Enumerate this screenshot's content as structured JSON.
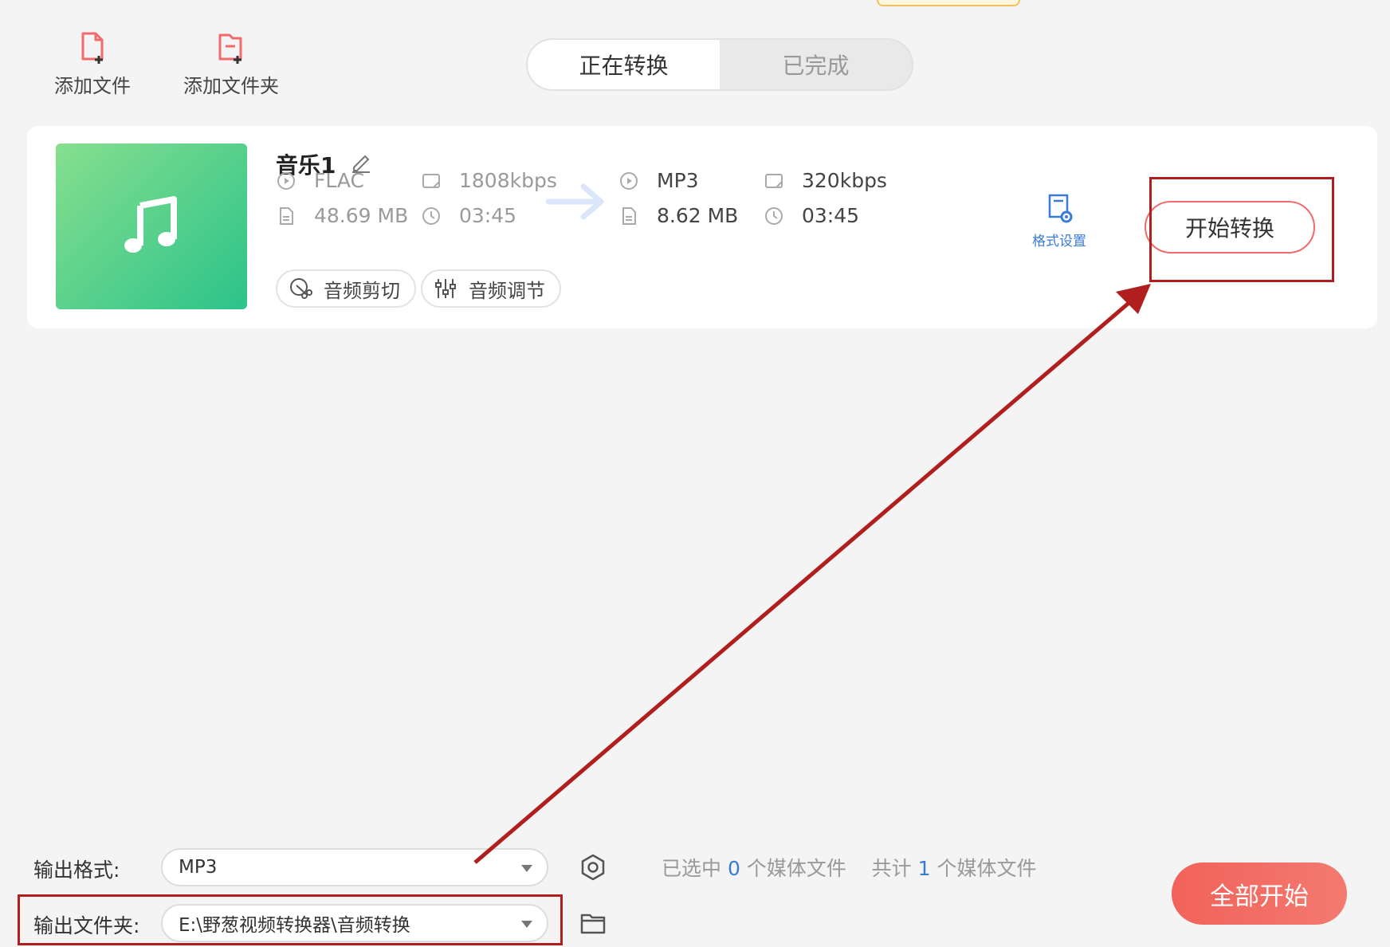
{
  "toolbar": {
    "add_file": "添加文件",
    "add_folder": "添加文件夹"
  },
  "tabs": {
    "converting": "正在转换",
    "completed": "已完成"
  },
  "file": {
    "name": "音乐1",
    "source": {
      "format": "FLAC",
      "bitrate": "1808kbps",
      "size": "48.69 MB",
      "duration": "03:45"
    },
    "target": {
      "format": "MP3",
      "bitrate": "320kbps",
      "size": "8.62 MB",
      "duration": "03:45"
    },
    "audio_cut": "音频剪切",
    "audio_adjust": "音频调节",
    "format_settings": "格式设置",
    "start_convert": "开始转换"
  },
  "bottom": {
    "output_format_label": "输出格式:",
    "output_format_value": "MP3",
    "output_folder_label": "输出文件夹:",
    "output_folder_value": "E:\\野葱视频转换器\\音频转换",
    "selected_prefix": "已选中",
    "selected_count": "0",
    "selected_suffix": "个媒体文件",
    "total_prefix": "共计",
    "total_count": "1",
    "total_suffix": "个媒体文件",
    "start_all": "全部开始"
  },
  "colors": {
    "accent_red": "#f2625a",
    "thumb_green_start": "#86df8e",
    "thumb_green_end": "#2cc38a",
    "link_blue": "#3a7bd5",
    "annotation_red": "#b01e1e"
  }
}
